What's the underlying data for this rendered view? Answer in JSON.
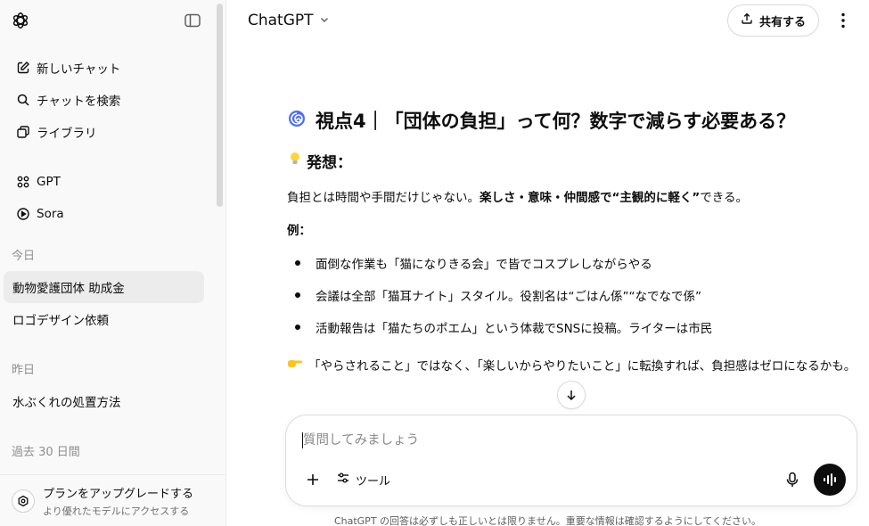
{
  "sidebar": {
    "menu": [
      {
        "label": "新しいチャット",
        "icon": "new-chat-icon"
      },
      {
        "label": "チャットを検索",
        "icon": "search-icon"
      },
      {
        "label": "ライブラリ",
        "icon": "library-icon"
      }
    ],
    "apps": [
      {
        "label": "GPT",
        "icon": "gpt-grid-icon"
      },
      {
        "label": "Sora",
        "icon": "sora-play-icon"
      }
    ],
    "sections": [
      {
        "title": "今日",
        "chats": [
          "動物愛護団体 助成金",
          "ロゴデザイン依頼"
        ]
      },
      {
        "title": "昨日",
        "chats": [
          "水ぶくれの処置方法"
        ]
      },
      {
        "title": "過去 30 日間",
        "chats": []
      }
    ],
    "active_chat": "動物愛護団体 助成金",
    "upgrade": {
      "title": "プランをアップグレードする",
      "subtitle": "より優れたモデルにアクセスする"
    }
  },
  "header": {
    "model": "ChatGPT",
    "share_label": "共有する"
  },
  "message": {
    "heading_emoji": "🌀",
    "heading": "視点4｜「団体の負担」って何？数字で減らす必要ある？",
    "subheading_emoji": "💡",
    "subheading": "発想：",
    "paragraph_plain": "負担とは時間や手間だけじゃない。",
    "paragraph_bold": "楽しさ・意味・仲間感で“主観的に軽く”",
    "paragraph_end": "できる。",
    "example_label": "例：",
    "bullets": [
      "面倒な作業も「猫になりきる会」で皆でコスプレしながらやる",
      "会議は全部「猫耳ナイト」スタイル。役割名は“ごはん係”“なでなで係”",
      "活動報告は「猫たちのポエム」という体裁でSNSに投稿。ライターは市民"
    ],
    "closing_emoji": "👉",
    "closing": "「やらされること」ではなく、「楽しいからやりたいこと」に転換すれば、負担感はゼロになるかも。"
  },
  "composer": {
    "placeholder": "質問してみましょう",
    "tools_label": "ツール"
  },
  "disclaimer": "ChatGPT の回答は必ずしも正しいとは限りません。重要な情報は確認するようにしてください。"
}
